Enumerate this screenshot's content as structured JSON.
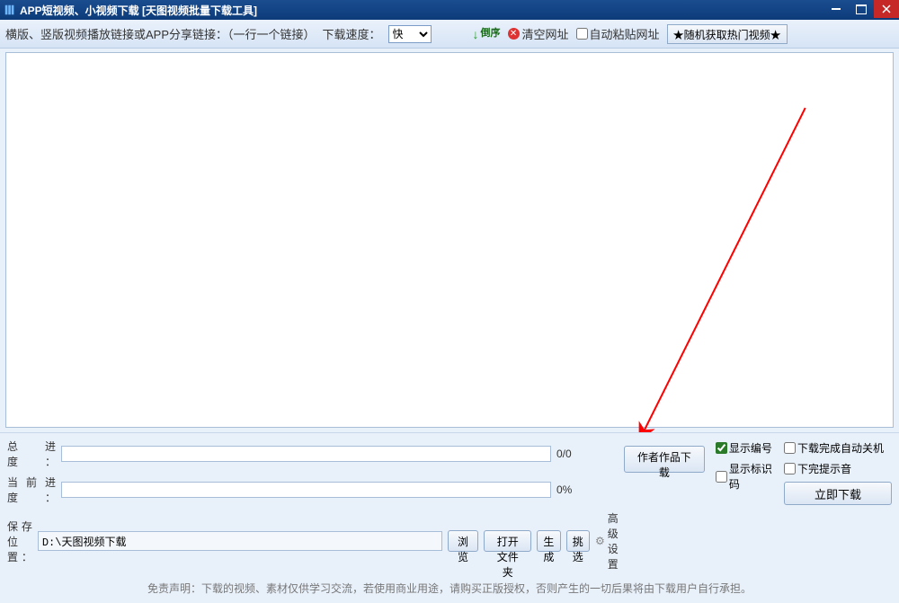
{
  "titlebar": {
    "title": "APP短视频、小视频下载 [天图视频批量下载工具]"
  },
  "toolbar": {
    "instruction": "横版、竖版视频播放链接或APP分享链接：（一行一个链接）",
    "speed_label": "下载速度：",
    "speed_value": "快",
    "reverse_label": "倒序",
    "clear_label": "清空网址",
    "auto_paste_label": "自动粘贴网址",
    "random_label": "★随机获取热门视频★"
  },
  "progress": {
    "total_label": "总 进 度：",
    "total_text": "0/0",
    "current_label": "当前进度：",
    "current_text": "0%"
  },
  "save": {
    "label": "保存位置：",
    "path": "D:\\天图视频下载",
    "browse": "浏览",
    "open_folder": "打开文件夹",
    "generate": "生成",
    "select": "挑选"
  },
  "actions": {
    "author_download": "作者作品下载",
    "show_number": "显示编号",
    "show_id_code": "显示标识码",
    "auto_shutdown": "下载完成自动关机",
    "sound_on_done": "下完提示音",
    "advanced": "高级设置",
    "download_now": "立即下载"
  },
  "disclaimer": "免责声明：下载的视频、素材仅供学习交流，若使用商业用途，请购买正版授权，否则产生的一切后果将由下载用户自行承担。"
}
